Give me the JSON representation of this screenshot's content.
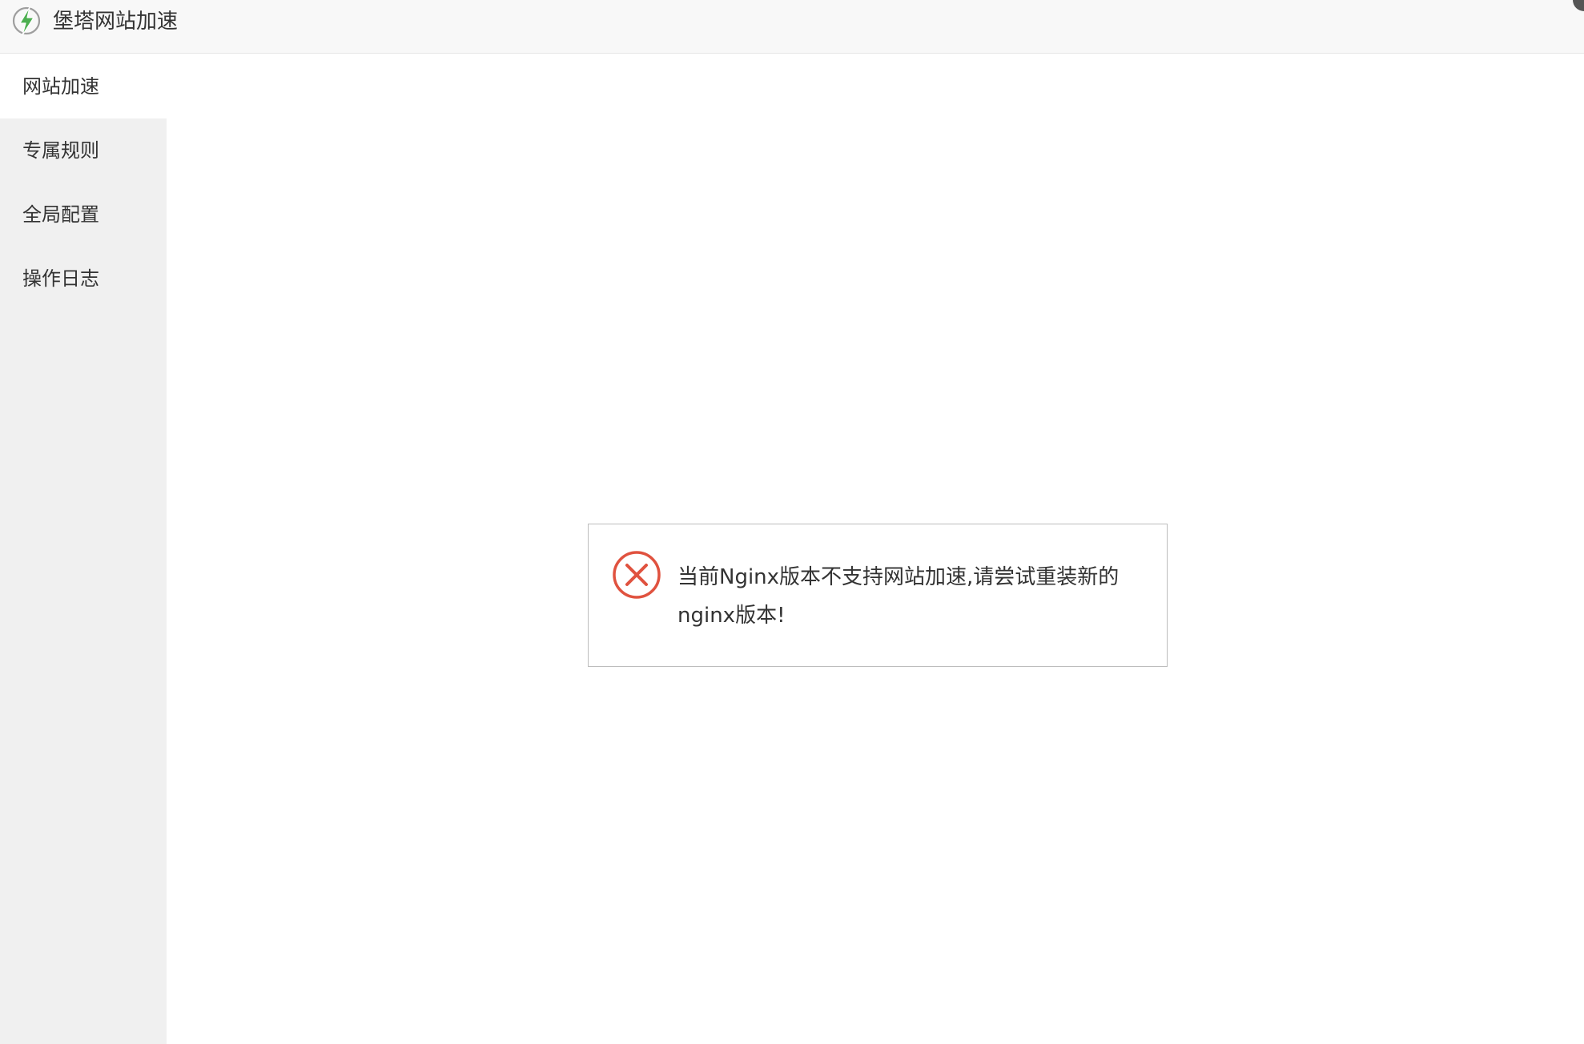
{
  "app": {
    "title": "堡塔网站加速",
    "logo_icon": "lightning-bolt-icon",
    "accent_color": "#4caf50"
  },
  "sidebar": {
    "items": [
      {
        "label": "网站加速",
        "active": true
      },
      {
        "label": "专属规则",
        "active": false
      },
      {
        "label": "全局配置",
        "active": false
      },
      {
        "label": "操作日志",
        "active": false
      }
    ]
  },
  "alert": {
    "icon": "error-x-icon",
    "icon_color": "#e0523f",
    "message": "当前Nginx版本不支持网站加速,请尝试重装新的nginx版本!"
  }
}
